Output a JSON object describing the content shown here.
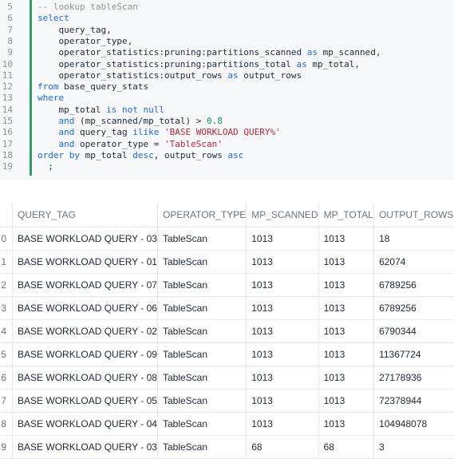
{
  "editor": {
    "lines": [
      {
        "n": "5",
        "segments": [
          {
            "t": "-- lookup tableScan",
            "c": "cm"
          }
        ]
      },
      {
        "n": "6",
        "segments": [
          {
            "t": "select",
            "c": "kw"
          }
        ]
      },
      {
        "n": "7",
        "segments": [
          {
            "t": "    query_tag,",
            "c": ""
          }
        ]
      },
      {
        "n": "8",
        "segments": [
          {
            "t": "    operator_type,",
            "c": ""
          }
        ]
      },
      {
        "n": "9",
        "segments": [
          {
            "t": "    operator_statistics:pruning:partitions_scanned ",
            "c": ""
          },
          {
            "t": "as",
            "c": "kw"
          },
          {
            "t": " mp_scanned,",
            "c": ""
          }
        ]
      },
      {
        "n": "10",
        "segments": [
          {
            "t": "    operator_statistics:pruning:partitions_total ",
            "c": ""
          },
          {
            "t": "as",
            "c": "kw"
          },
          {
            "t": " mp_total,",
            "c": ""
          }
        ]
      },
      {
        "n": "11",
        "segments": [
          {
            "t": "    operator_statistics:output_rows ",
            "c": ""
          },
          {
            "t": "as",
            "c": "kw"
          },
          {
            "t": " output_rows",
            "c": ""
          }
        ]
      },
      {
        "n": "12",
        "segments": [
          {
            "t": "from",
            "c": "kw"
          },
          {
            "t": " base_query_stats",
            "c": ""
          }
        ]
      },
      {
        "n": "13",
        "segments": [
          {
            "t": "where",
            "c": "kw"
          }
        ]
      },
      {
        "n": "14",
        "segments": [
          {
            "t": "    mp_total ",
            "c": ""
          },
          {
            "t": "is not null",
            "c": "kw"
          }
        ]
      },
      {
        "n": "15",
        "segments": [
          {
            "t": "    ",
            "c": ""
          },
          {
            "t": "and",
            "c": "kw"
          },
          {
            "t": " (mp_scanned/mp_total) > ",
            "c": ""
          },
          {
            "t": "0.8",
            "c": "num"
          }
        ]
      },
      {
        "n": "16",
        "segments": [
          {
            "t": "    ",
            "c": ""
          },
          {
            "t": "and",
            "c": "kw"
          },
          {
            "t": " query_tag ",
            "c": ""
          },
          {
            "t": "ilike",
            "c": "kw"
          },
          {
            "t": " ",
            "c": ""
          },
          {
            "t": "'BASE WORKLOAD QUERY%'",
            "c": "str"
          }
        ]
      },
      {
        "n": "17",
        "segments": [
          {
            "t": "    ",
            "c": ""
          },
          {
            "t": "and",
            "c": "kw"
          },
          {
            "t": " operator_type = ",
            "c": ""
          },
          {
            "t": "'TableScan'",
            "c": "str"
          }
        ]
      },
      {
        "n": "18",
        "segments": [
          {
            "t": "order by",
            "c": "kw"
          },
          {
            "t": " mp_total ",
            "c": ""
          },
          {
            "t": "desc",
            "c": "kw"
          },
          {
            "t": ", output_rows ",
            "c": ""
          },
          {
            "t": "asc",
            "c": "kw"
          }
        ]
      },
      {
        "n": "19",
        "segments": [
          {
            "t": "  ;",
            "c": ""
          }
        ]
      }
    ]
  },
  "results": {
    "columns": [
      "QUERY_TAG",
      "OPERATOR_TYPE",
      "MP_SCANNED",
      "MP_TOTAL",
      "OUTPUT_ROWS"
    ],
    "rows": [
      [
        "0",
        "BASE WORKLOAD QUERY - 03",
        "TableScan",
        "1013",
        "1013",
        "18"
      ],
      [
        "1",
        "BASE WORKLOAD QUERY - 01",
        "TableScan",
        "1013",
        "1013",
        "62074"
      ],
      [
        "2",
        "BASE WORKLOAD QUERY - 07",
        "TableScan",
        "1013",
        "1013",
        "6789256"
      ],
      [
        "3",
        "BASE WORKLOAD QUERY - 06",
        "TableScan",
        "1013",
        "1013",
        "6789256"
      ],
      [
        "4",
        "BASE WORKLOAD QUERY - 02",
        "TableScan",
        "1013",
        "1013",
        "6790344"
      ],
      [
        "5",
        "BASE WORKLOAD QUERY - 09",
        "TableScan",
        "1013",
        "1013",
        "11367724"
      ],
      [
        "6",
        "BASE WORKLOAD QUERY - 08",
        "TableScan",
        "1013",
        "1013",
        "27178936"
      ],
      [
        "7",
        "BASE WORKLOAD QUERY - 05",
        "TableScan",
        "1013",
        "1013",
        "72378944"
      ],
      [
        "8",
        "BASE WORKLOAD QUERY - 04",
        "TableScan",
        "1013",
        "1013",
        "104948078"
      ],
      [
        "9",
        "BASE WORKLOAD QUERY - 03",
        "TableScan",
        "68",
        "68",
        "3"
      ]
    ]
  }
}
